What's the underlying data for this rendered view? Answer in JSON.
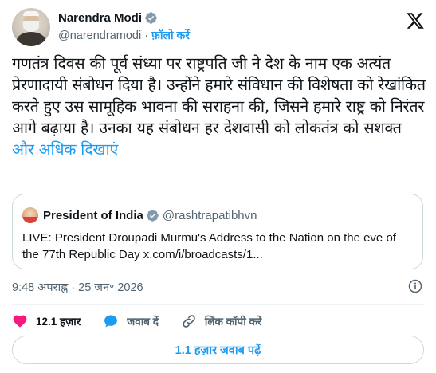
{
  "author": {
    "name": "Narendra Modi",
    "handle": "@narendramodi",
    "separator": "·",
    "follow_label": "फ़ॉलो करें"
  },
  "tweet": {
    "text": "गणतंत्र दिवस की पूर्व संध्या पर राष्ट्रपति जी ने देश के नाम एक अत्यंत प्रेरणादायी संबोधन दिया है। उन्होंने हमारे संविधान की विशेषता को रेखांकित करते हुए उस सामूहिक भावना की सराहना की, जिसने हमारे राष्ट्र को निरंतर आगे बढ़ाया है। उनका यह संबोधन हर देशवासी को लोकतंत्र को सशक्त",
    "show_more": "और अधिक दिखाएं"
  },
  "quote": {
    "name": "President of India",
    "handle": "@rashtrapatibhvn",
    "text": "LIVE: President Droupadi Murmu's Address to the Nation on the eve of the 77th Republic Day x.com/i/broadcasts/1..."
  },
  "meta": {
    "timestamp": "9:48 अपराह्न · 25 जन॰ 2026"
  },
  "actions": {
    "likes": "12.1 हज़ार",
    "reply": "जवाब दें",
    "copy_link": "लिंक कॉपी करें"
  },
  "replies_button": "1.1 हज़ार जवाब पढ़ें",
  "colors": {
    "accent": "#1d9bf0",
    "like": "#f91880",
    "text": "#0f1419",
    "muted": "#536471",
    "border": "#cfd9de"
  },
  "icons": [
    "verified-badge-icon",
    "x-logo-icon",
    "info-icon",
    "heart-icon",
    "reply-bubble-icon",
    "link-icon"
  ]
}
